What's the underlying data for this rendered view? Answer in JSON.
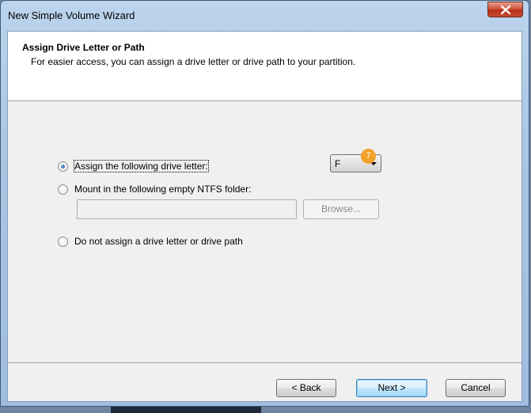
{
  "window": {
    "title": "New Simple Volume Wizard"
  },
  "header": {
    "title": "Assign Drive Letter or Path",
    "subtitle": "For easier access, you can assign a drive letter or drive path to your partition."
  },
  "options": {
    "assign_letter": {
      "label": "Assign the following drive letter:",
      "checked": true
    },
    "mount_folder": {
      "label": "Mount in the following empty NTFS folder:",
      "checked": false
    },
    "no_assign": {
      "label": "Do not assign a drive letter or drive path",
      "checked": false
    }
  },
  "drive_letter": {
    "value": "F",
    "badge": "7"
  },
  "folder_path": {
    "value": ""
  },
  "buttons": {
    "browse": "Browse...",
    "back": "< Back",
    "next": "Next >",
    "cancel": "Cancel"
  },
  "colors": {
    "accent": "#f2a12a",
    "title_bar": "#a9c5e4",
    "close": "#c84a30"
  }
}
